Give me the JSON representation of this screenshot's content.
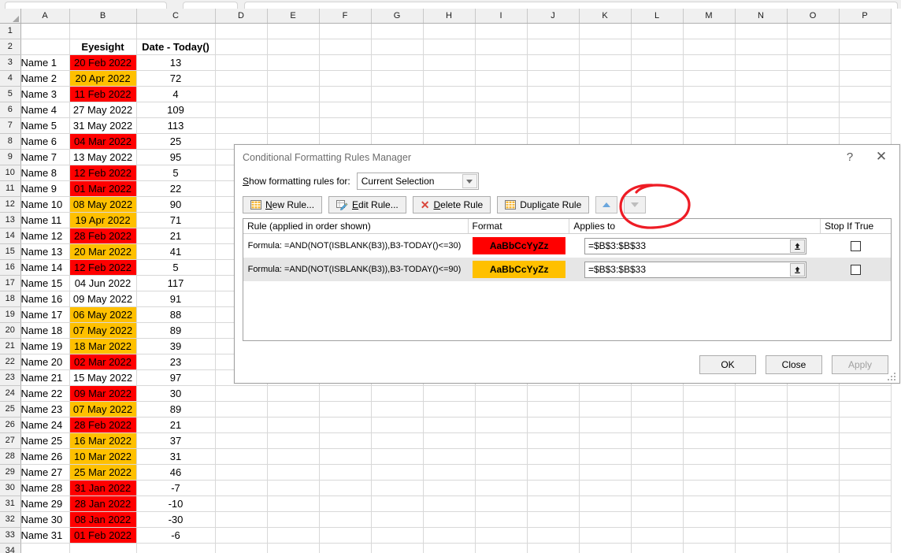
{
  "spreadsheet": {
    "column_headers": [
      "A",
      "B",
      "C",
      "D",
      "E",
      "F",
      "G",
      "H",
      "I",
      "J",
      "K",
      "L",
      "M",
      "N",
      "O",
      "P"
    ],
    "header_row": {
      "row": "2",
      "b": "Eyesight",
      "c": "Date  - Today()"
    },
    "rows": [
      {
        "row": "1",
        "a": "",
        "b": "",
        "c": "",
        "fill": "none"
      },
      {
        "row": "2",
        "a": "",
        "b": "Eyesight",
        "c": "Date  - Today()",
        "fill": "none",
        "bold": true
      },
      {
        "row": "3",
        "a": "Name 1",
        "b": "20 Feb 2022",
        "c": "13",
        "fill": "red"
      },
      {
        "row": "4",
        "a": "Name 2",
        "b": "20 Apr 2022",
        "c": "72",
        "fill": "orange"
      },
      {
        "row": "5",
        "a": "Name 3",
        "b": "11 Feb 2022",
        "c": "4",
        "fill": "red"
      },
      {
        "row": "6",
        "a": "Name 4",
        "b": "27 May 2022",
        "c": "109",
        "fill": "none"
      },
      {
        "row": "7",
        "a": "Name 5",
        "b": "31 May 2022",
        "c": "113",
        "fill": "none"
      },
      {
        "row": "8",
        "a": "Name 6",
        "b": "04 Mar 2022",
        "c": "25",
        "fill": "red"
      },
      {
        "row": "9",
        "a": "Name 7",
        "b": "13 May 2022",
        "c": "95",
        "fill": "none"
      },
      {
        "row": "10",
        "a": "Name 8",
        "b": "12 Feb 2022",
        "c": "5",
        "fill": "red"
      },
      {
        "row": "11",
        "a": "Name 9",
        "b": "01 Mar 2022",
        "c": "22",
        "fill": "red"
      },
      {
        "row": "12",
        "a": "Name 10",
        "b": "08 May 2022",
        "c": "90",
        "fill": "orange"
      },
      {
        "row": "13",
        "a": "Name 11",
        "b": "19 Apr 2022",
        "c": "71",
        "fill": "orange"
      },
      {
        "row": "14",
        "a": "Name 12",
        "b": "28 Feb 2022",
        "c": "21",
        "fill": "red"
      },
      {
        "row": "15",
        "a": "Name 13",
        "b": "20 Mar 2022",
        "c": "41",
        "fill": "orange"
      },
      {
        "row": "16",
        "a": "Name 14",
        "b": "12 Feb 2022",
        "c": "5",
        "fill": "red"
      },
      {
        "row": "17",
        "a": "Name 15",
        "b": "04 Jun 2022",
        "c": "117",
        "fill": "none"
      },
      {
        "row": "18",
        "a": "Name 16",
        "b": "09 May 2022",
        "c": "91",
        "fill": "none"
      },
      {
        "row": "19",
        "a": "Name 17",
        "b": "06 May 2022",
        "c": "88",
        "fill": "orange"
      },
      {
        "row": "20",
        "a": "Name 18",
        "b": "07 May 2022",
        "c": "89",
        "fill": "orange"
      },
      {
        "row": "21",
        "a": "Name 19",
        "b": "18 Mar 2022",
        "c": "39",
        "fill": "orange"
      },
      {
        "row": "22",
        "a": "Name 20",
        "b": "02 Mar 2022",
        "c": "23",
        "fill": "red"
      },
      {
        "row": "23",
        "a": "Name 21",
        "b": "15 May 2022",
        "c": "97",
        "fill": "none"
      },
      {
        "row": "24",
        "a": "Name 22",
        "b": "09 Mar 2022",
        "c": "30",
        "fill": "red"
      },
      {
        "row": "25",
        "a": "Name 23",
        "b": "07 May 2022",
        "c": "89",
        "fill": "orange"
      },
      {
        "row": "26",
        "a": "Name 24",
        "b": "28 Feb 2022",
        "c": "21",
        "fill": "red"
      },
      {
        "row": "27",
        "a": "Name 25",
        "b": "16 Mar 2022",
        "c": "37",
        "fill": "orange"
      },
      {
        "row": "28",
        "a": "Name 26",
        "b": "10 Mar 2022",
        "c": "31",
        "fill": "orange"
      },
      {
        "row": "29",
        "a": "Name 27",
        "b": "25 Mar 2022",
        "c": "46",
        "fill": "orange"
      },
      {
        "row": "30",
        "a": "Name 28",
        "b": "31 Jan 2022",
        "c": "-7",
        "fill": "red"
      },
      {
        "row": "31",
        "a": "Name 29",
        "b": "28 Jan 2022",
        "c": "-10",
        "fill": "red"
      },
      {
        "row": "32",
        "a": "Name 30",
        "b": "08 Jan 2022",
        "c": "-30",
        "fill": "red"
      },
      {
        "row": "33",
        "a": "Name 31",
        "b": "01 Feb 2022",
        "c": "-6",
        "fill": "red"
      },
      {
        "row": "34",
        "a": "",
        "b": "",
        "c": "",
        "fill": "none"
      }
    ]
  },
  "dialog": {
    "title": "Conditional Formatting Rules Manager",
    "help_glyph": "?",
    "close_glyph": "✕",
    "show_rules_label": "Show formatting rules for:",
    "show_rules_value": "Current Selection",
    "toolbar": {
      "new_rule": "New Rule...",
      "edit_rule": "Edit Rule...",
      "delete_rule": "Delete Rule",
      "duplicate_rule": "Duplicate Rule",
      "move_up": "⌃",
      "move_down": "⌄"
    },
    "table_headers": {
      "rule": "Rule (applied in order shown)",
      "format": "Format",
      "applies_to": "Applies to",
      "stop_if_true": "Stop If True"
    },
    "rules": [
      {
        "rule_text": "Formula:  =AND(NOT(ISBLANK(B3)),B3-TODAY()<=30)",
        "preview_text": "AaBbCcYyZz",
        "fill_color": "#FF0000",
        "applies_to": "=$B$3:$B$33",
        "stop_if_true": false
      },
      {
        "rule_text": "Formula:  =AND(NOT(ISBLANK(B3)),B3-TODAY()<=90)",
        "preview_text": "AaBbCcYyZz",
        "fill_color": "#FFC000",
        "applies_to": "=$B$3:$B$33",
        "stop_if_true": false
      }
    ],
    "footer": {
      "ok": "OK",
      "close": "Close",
      "apply": "Apply"
    }
  },
  "annotation": {
    "color": "#EE1C25",
    "target": "move-up-down-arrow-buttons"
  }
}
